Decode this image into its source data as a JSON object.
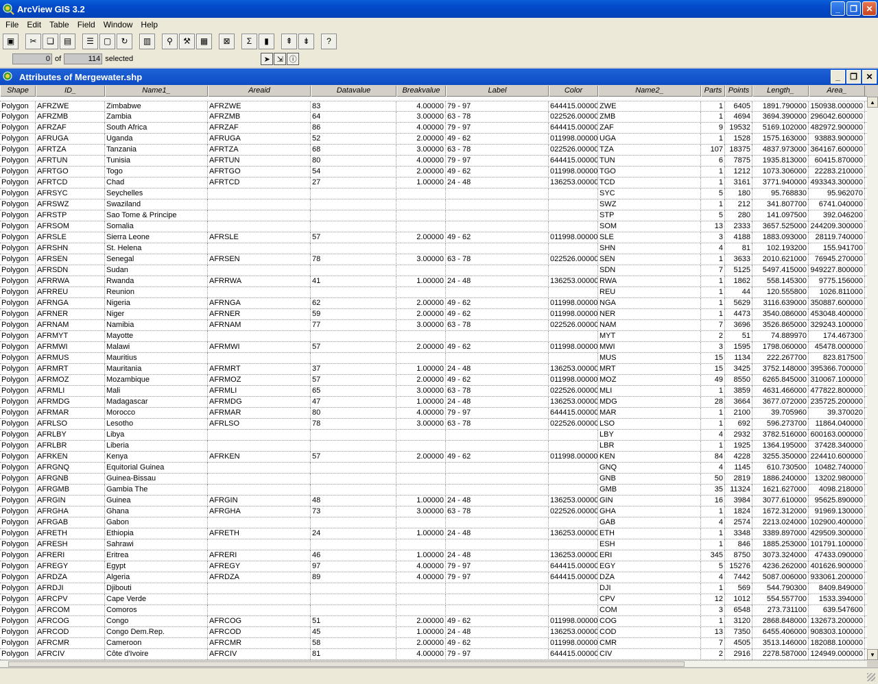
{
  "app": {
    "title": "ArcView GIS 3.2"
  },
  "menu": [
    "File",
    "Edit",
    "Table",
    "Field",
    "Window",
    "Help"
  ],
  "toolbar": {
    "icons": [
      "save-icon",
      "cut-icon",
      "copy-icon",
      "paste-icon",
      "table-icon",
      "blank-icon",
      "refresh-icon",
      "chart-icon",
      "find-icon",
      "query-icon",
      "columns-icon",
      "clear-icon",
      "sum-icon",
      "calc-icon",
      "sort-ascending-icon",
      "sort-descending-icon",
      "help-icon"
    ]
  },
  "status": {
    "selected_count": "0",
    "of_label": "of",
    "total": "114",
    "selected_label": "selected"
  },
  "child_window": {
    "title": "Attributes of Mergewater.shp"
  },
  "columns": [
    "Shape",
    "ID_",
    "Name1_",
    "Areaid",
    "Datavalue",
    "Breakvalue",
    "Label",
    "Color",
    "Name2_",
    "Parts",
    "Points",
    "Length_",
    "Area_"
  ],
  "rows": [
    [
      "Polygon",
      "AFRZWE",
      "Zimbabwe",
      "AFRZWE",
      "83",
      "4.00000",
      "79 - 97",
      "644415.00000",
      "ZWE",
      "1",
      "6405",
      "1891.790000",
      "150938.000000"
    ],
    [
      "Polygon",
      "AFRZMB",
      "Zambia",
      "AFRZMB",
      "64",
      "3.00000",
      "63 - 78",
      "022526.00000",
      "ZMB",
      "1",
      "4694",
      "3694.390000",
      "296042.600000"
    ],
    [
      "Polygon",
      "AFRZAF",
      "South Africa",
      "AFRZAF",
      "86",
      "4.00000",
      "79 - 97",
      "644415.00000",
      "ZAF",
      "9",
      "19532",
      "5169.102000",
      "482972.900000"
    ],
    [
      "Polygon",
      "AFRUGA",
      "Uganda",
      "AFRUGA",
      "52",
      "2.00000",
      "49 - 62",
      "011998.00000",
      "UGA",
      "1",
      "1528",
      "1575.163000",
      "93883.900000"
    ],
    [
      "Polygon",
      "AFRTZA",
      "Tanzania",
      "AFRTZA",
      "68",
      "3.00000",
      "63 - 78",
      "022526.00000",
      "TZA",
      "107",
      "18375",
      "4837.973000",
      "364167.600000"
    ],
    [
      "Polygon",
      "AFRTUN",
      "Tunisia",
      "AFRTUN",
      "80",
      "4.00000",
      "79 - 97",
      "644415.00000",
      "TUN",
      "6",
      "7875",
      "1935.813000",
      "60415.870000"
    ],
    [
      "Polygon",
      "AFRTGO",
      "Togo",
      "AFRTGO",
      "54",
      "2.00000",
      "49 - 62",
      "011998.00000",
      "TGO",
      "1",
      "1212",
      "1073.306000",
      "22283.210000"
    ],
    [
      "Polygon",
      "AFRTCD",
      "Chad",
      "AFRTCD",
      "27",
      "1.00000",
      "24 - 48",
      "136253.00000",
      "TCD",
      "1",
      "3161",
      "3771.940000",
      "493343.300000"
    ],
    [
      "Polygon",
      "AFRSYC",
      "Seychelles",
      "",
      "",
      "",
      "",
      "",
      "SYC",
      "5",
      "180",
      "95.768830",
      "95.962070"
    ],
    [
      "Polygon",
      "AFRSWZ",
      "Swaziland",
      "",
      "",
      "",
      "",
      "",
      "SWZ",
      "1",
      "212",
      "341.807700",
      "6741.040000"
    ],
    [
      "Polygon",
      "AFRSTP",
      "Sao Tome & Principe",
      "",
      "",
      "",
      "",
      "",
      "STP",
      "5",
      "280",
      "141.097500",
      "392.046200"
    ],
    [
      "Polygon",
      "AFRSOM",
      "Somalia",
      "",
      "",
      "",
      "",
      "",
      "SOM",
      "13",
      "2333",
      "3657.525000",
      "244209.300000"
    ],
    [
      "Polygon",
      "AFRSLE",
      "Sierra Leone",
      "AFRSLE",
      "57",
      "2.00000",
      "49 - 62",
      "011998.00000",
      "SLE",
      "3",
      "4188",
      "1883.093000",
      "28119.740000"
    ],
    [
      "Polygon",
      "AFRSHN",
      "St. Helena",
      "",
      "",
      "",
      "",
      "",
      "SHN",
      "4",
      "81",
      "102.193200",
      "155.941700"
    ],
    [
      "Polygon",
      "AFRSEN",
      "Senegal",
      "AFRSEN",
      "78",
      "3.00000",
      "63 - 78",
      "022526.00000",
      "SEN",
      "1",
      "3633",
      "2010.621000",
      "76945.270000"
    ],
    [
      "Polygon",
      "AFRSDN",
      "Sudan",
      "",
      "",
      "",
      "",
      "",
      "SDN",
      "7",
      "5125",
      "5497.415000",
      "949227.800000"
    ],
    [
      "Polygon",
      "AFRRWA",
      "Rwanda",
      "AFRRWA",
      "41",
      "1.00000",
      "24 - 48",
      "136253.00000",
      "RWA",
      "1",
      "1862",
      "558.145300",
      "9775.156000"
    ],
    [
      "Polygon",
      "AFRREU",
      "Reunion",
      "",
      "",
      "",
      "",
      "",
      "REU",
      "1",
      "44",
      "120.555800",
      "1026.811000"
    ],
    [
      "Polygon",
      "AFRNGA",
      "Nigeria",
      "AFRNGA",
      "62",
      "2.00000",
      "49 - 62",
      "011998.00000",
      "NGA",
      "1",
      "5629",
      "3116.639000",
      "350887.600000"
    ],
    [
      "Polygon",
      "AFRNER",
      "Niger",
      "AFRNER",
      "59",
      "2.00000",
      "49 - 62",
      "011998.00000",
      "NER",
      "1",
      "4473",
      "3540.086000",
      "453048.400000"
    ],
    [
      "Polygon",
      "AFRNAM",
      "Namibia",
      "AFRNAM",
      "77",
      "3.00000",
      "63 - 78",
      "022526.00000",
      "NAM",
      "7",
      "3696",
      "3526.865000",
      "329243.100000"
    ],
    [
      "Polygon",
      "AFRMYT",
      "Mayotte",
      "",
      "",
      "",
      "",
      "",
      "MYT",
      "2",
      "51",
      "74.889970",
      "174.467300"
    ],
    [
      "Polygon",
      "AFRMWI",
      "Malawi",
      "AFRMWI",
      "57",
      "2.00000",
      "49 - 62",
      "011998.00000",
      "MWI",
      "3",
      "1595",
      "1798.060000",
      "45478.000000"
    ],
    [
      "Polygon",
      "AFRMUS",
      "Mauritius",
      "",
      "",
      "",
      "",
      "",
      "MUS",
      "15",
      "1134",
      "222.267700",
      "823.817500"
    ],
    [
      "Polygon",
      "AFRMRT",
      "Mauritania",
      "AFRMRT",
      "37",
      "1.00000",
      "24 - 48",
      "136253.00000",
      "MRT",
      "15",
      "3425",
      "3752.148000",
      "395366.700000"
    ],
    [
      "Polygon",
      "AFRMOZ",
      "Mozambique",
      "AFRMOZ",
      "57",
      "2.00000",
      "49 - 62",
      "011998.00000",
      "MOZ",
      "49",
      "8550",
      "6265.845000",
      "310067.100000"
    ],
    [
      "Polygon",
      "AFRMLI",
      "Mali",
      "AFRMLI",
      "65",
      "3.00000",
      "63 - 78",
      "022526.00000",
      "MLI",
      "1",
      "3859",
      "4631.466000",
      "477822.800000"
    ],
    [
      "Polygon",
      "AFRMDG",
      "Madagascar",
      "AFRMDG",
      "47",
      "1.00000",
      "24 - 48",
      "136253.00000",
      "MDG",
      "28",
      "3664",
      "3677.072000",
      "235725.200000"
    ],
    [
      "Polygon",
      "AFRMAR",
      "Morocco",
      "AFRMAR",
      "80",
      "4.00000",
      "79 - 97",
      "644415.00000",
      "MAR",
      "1",
      "2100",
      "39.705960",
      "39.370020"
    ],
    [
      "Polygon",
      "AFRLSO",
      "Lesotho",
      "AFRLSO",
      "78",
      "3.00000",
      "63 - 78",
      "022526.00000",
      "LSO",
      "1",
      "692",
      "596.273700",
      "11864.040000"
    ],
    [
      "Polygon",
      "AFRLBY",
      "Libya",
      "",
      "",
      "",
      "",
      "",
      "LBY",
      "4",
      "2932",
      "3782.516000",
      "600163.000000"
    ],
    [
      "Polygon",
      "AFRLBR",
      "Liberia",
      "",
      "",
      "",
      "",
      "",
      "LBR",
      "1",
      "1925",
      "1364.195000",
      "37428.340000"
    ],
    [
      "Polygon",
      "AFRKEN",
      "Kenya",
      "AFRKEN",
      "57",
      "2.00000",
      "49 - 62",
      "011998.00000",
      "KEN",
      "84",
      "4228",
      "3255.350000",
      "224410.600000"
    ],
    [
      "Polygon",
      "AFRGNQ",
      "Equitorial Guinea",
      "",
      "",
      "",
      "",
      "",
      "GNQ",
      "4",
      "1145",
      "610.730500",
      "10482.740000"
    ],
    [
      "Polygon",
      "AFRGNB",
      "Guinea-Bissau",
      "",
      "",
      "",
      "",
      "",
      "GNB",
      "50",
      "2819",
      "1886.240000",
      "13202.980000"
    ],
    [
      "Polygon",
      "AFRGMB",
      "Gambia The",
      "",
      "",
      "",
      "",
      "",
      "GMB",
      "35",
      "11324",
      "1621.627000",
      "4098.218000"
    ],
    [
      "Polygon",
      "AFRGIN",
      "Guinea",
      "AFRGIN",
      "48",
      "1.00000",
      "24 - 48",
      "136253.00000",
      "GIN",
      "16",
      "3984",
      "3077.610000",
      "95625.890000"
    ],
    [
      "Polygon",
      "AFRGHA",
      "Ghana",
      "AFRGHA",
      "73",
      "3.00000",
      "63 - 78",
      "022526.00000",
      "GHA",
      "1",
      "1824",
      "1672.312000",
      "91969.130000"
    ],
    [
      "Polygon",
      "AFRGAB",
      "Gabon",
      "",
      "",
      "",
      "",
      "",
      "GAB",
      "4",
      "2574",
      "2213.024000",
      "102900.400000"
    ],
    [
      "Polygon",
      "AFRETH",
      "Ethiopia",
      "AFRETH",
      "24",
      "1.00000",
      "24 - 48",
      "136253.00000",
      "ETH",
      "1",
      "3348",
      "3389.897000",
      "429509.300000"
    ],
    [
      "Polygon",
      "AFRESH",
      "Sahrawi",
      "",
      "",
      "",
      "",
      "",
      "ESH",
      "1",
      "846",
      "1885.253000",
      "101791.100000"
    ],
    [
      "Polygon",
      "AFRERI",
      "Eritrea",
      "AFRERI",
      "46",
      "1.00000",
      "24 - 48",
      "136253.00000",
      "ERI",
      "345",
      "8750",
      "3073.324000",
      "47433.090000"
    ],
    [
      "Polygon",
      "AFREGY",
      "Egypt",
      "AFREGY",
      "97",
      "4.00000",
      "79 - 97",
      "644415.00000",
      "EGY",
      "5",
      "15276",
      "4236.262000",
      "401626.900000"
    ],
    [
      "Polygon",
      "AFRDZA",
      "Algeria",
      "AFRDZA",
      "89",
      "4.00000",
      "79 - 97",
      "644415.00000",
      "DZA",
      "4",
      "7442",
      "5087.006000",
      "933061.200000"
    ],
    [
      "Polygon",
      "AFRDJI",
      "Djibouti",
      "",
      "",
      "",
      "",
      "",
      "DJI",
      "1",
      "569",
      "544.790300",
      "8409.849000"
    ],
    [
      "Polygon",
      "AFRCPV",
      "Cape Verde",
      "",
      "",
      "",
      "",
      "",
      "CPV",
      "12",
      "1012",
      "554.557700",
      "1533.394000"
    ],
    [
      "Polygon",
      "AFRCOM",
      "Comoros",
      "",
      "",
      "",
      "",
      "",
      "COM",
      "3",
      "6548",
      "273.731100",
      "639.547600"
    ],
    [
      "Polygon",
      "AFRCOG",
      "Congo",
      "AFRCOG",
      "51",
      "2.00000",
      "49 - 62",
      "011998.00000",
      "COG",
      "1",
      "3120",
      "2868.848000",
      "132673.200000"
    ],
    [
      "Polygon",
      "AFRCOD",
      "Congo Dem.Rep.",
      "AFRCOD",
      "45",
      "1.00000",
      "24 - 48",
      "136253.00000",
      "COD",
      "13",
      "7350",
      "6455.406000",
      "908303.100000"
    ],
    [
      "Polygon",
      "AFRCMR",
      "Cameroon",
      "AFRCMR",
      "58",
      "2.00000",
      "49 - 62",
      "011998.00000",
      "CMR",
      "7",
      "4505",
      "3513.146000",
      "182088.100000"
    ],
    [
      "Polygon",
      "AFRCIV",
      "Côte d'Ivoire",
      "AFRCIV",
      "81",
      "4.00000",
      "79 - 97",
      "644415.00000",
      "CIV",
      "2",
      "2916",
      "2278.587000",
      "124949.000000"
    ]
  ]
}
